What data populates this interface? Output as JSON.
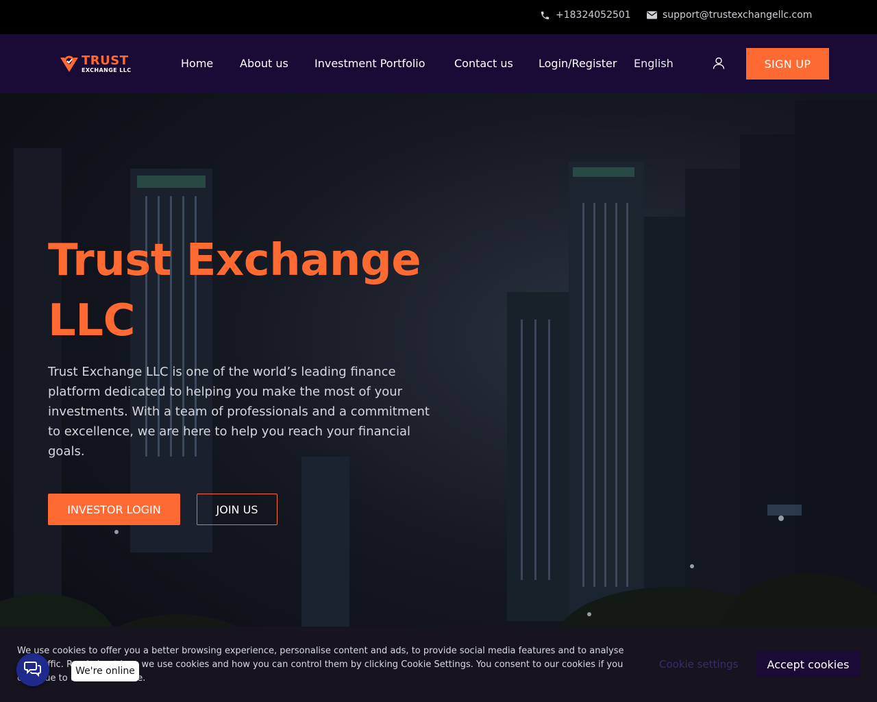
{
  "topbar": {
    "phone": "+18324052501",
    "email": "support@trustexchangellc.com",
    "phone_icon": "phone-icon",
    "email_icon": "envelope-icon"
  },
  "brand": {
    "logo_line1": "TRUST",
    "logo_line2": "EXCHANGE LLC",
    "accent_color": "#ff6a33",
    "nav_color": "#1a0b36"
  },
  "nav": {
    "items": [
      "Home",
      "About us",
      "Investment Portfolio",
      "Contact us",
      "Login/Register"
    ],
    "language": "English",
    "signup_label": "SIGN UP",
    "user_icon": "user-icon"
  },
  "hero": {
    "title": "Trust Exchange LLC",
    "description": "Trust Exchange LLC is one of the world’s leading finance platform dedicated to helping you make the most of your investments. With a team of professionals and a commitment to excellence, we are here to help you reach your financial goals.",
    "primary_button": "INVESTOR LOGIN",
    "secondary_button": "JOIN US"
  },
  "cookie": {
    "text": "We use cookies to offer you a better browsing experience, personalise content and ads, to provide social media features and to analyse our traffic. Read about how we use cookies and how you can control them by clicking Cookie Settings. You consent to our cookies if you continue to use this website.",
    "settings_label": "Cookie settings",
    "accept_label": "Accept cookies"
  },
  "chat": {
    "status_label": "We're online",
    "icon": "chat-icon"
  }
}
